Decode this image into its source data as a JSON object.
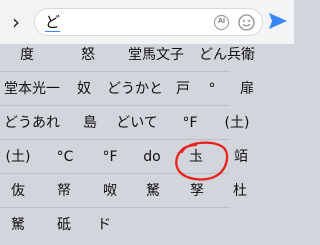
{
  "input": {
    "text": "ど"
  },
  "rows": [
    [
      "度",
      "怒",
      "堂馬文子",
      "どん兵衛"
    ],
    [
      "堂本光一",
      "奴",
      "どうかと",
      "戸",
      "°",
      "扉"
    ],
    [
      "どうあれ",
      "島",
      "どいて",
      "°F",
      "(土)"
    ],
    [
      "(土)",
      "°C",
      "°F",
      "do",
      "圡",
      "竡"
    ],
    [
      "伖",
      "帑",
      "呶",
      "駑",
      "孥",
      "杜"
    ],
    [
      "駑",
      "砥",
      "ド"
    ]
  ],
  "annotation": {
    "color": "#e8231c"
  },
  "colors": {
    "accent": "#3a86f4",
    "background": "#d2d5db"
  }
}
